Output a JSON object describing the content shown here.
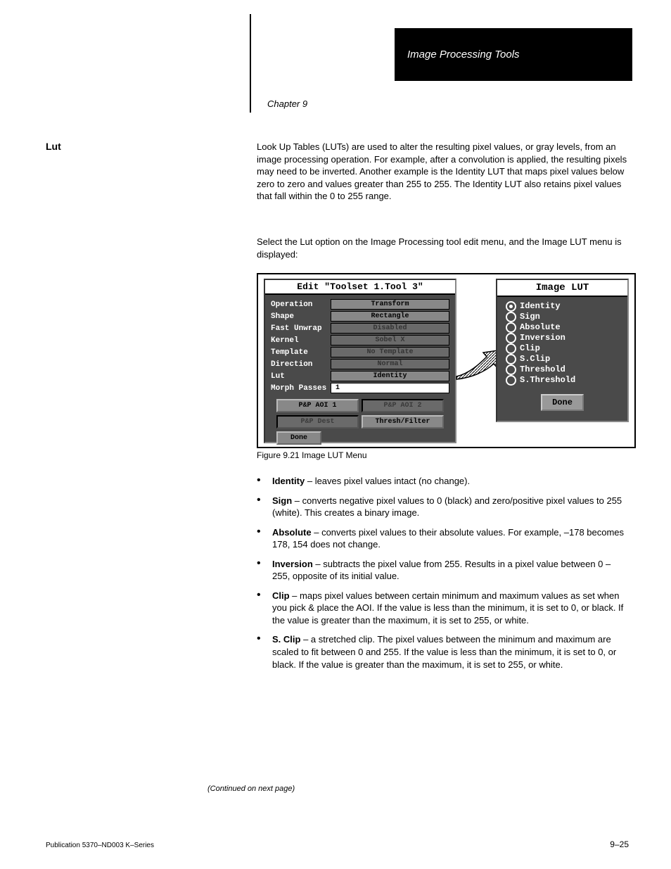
{
  "header": {
    "banner_text": "Image Processing Tools",
    "chapter": "Chapter 9"
  },
  "sections": {
    "lut_heading": "Lut",
    "lut_body": "Look Up Tables (LUTs) are used to alter the resulting pixel values, or gray levels, from an image processing operation. For example, after a convolution is applied, the resulting pixels may need to be inverted. Another example is  the Identity LUT that maps pixel values below zero to zero and values greater than 255 to 255. The Identity LUT also retains pixel values that fall within the 0 to 255 range.",
    "select_lut_body": "Select the Lut option on the Image Processing tool edit menu, and the Image LUT menu is displayed:"
  },
  "figure": {
    "caption": "Figure 9.21 Image LUT Menu",
    "edit_panel": {
      "title": "Edit \"Toolset 1.Tool 3\"",
      "rows": [
        {
          "label": "Operation",
          "value": "Transform",
          "disabled": false
        },
        {
          "label": "Shape",
          "value": "Rectangle",
          "disabled": false
        },
        {
          "label": "Fast Unwrap",
          "value": "Disabled",
          "disabled": true
        },
        {
          "label": "Kernel",
          "value": "Sobel X",
          "disabled": true
        },
        {
          "label": "Template",
          "value": "No Template",
          "disabled": true
        },
        {
          "label": "Direction",
          "value": "Normal",
          "disabled": true
        },
        {
          "label": "Lut",
          "value": "Identity",
          "disabled": false
        },
        {
          "label": "Morph Passes",
          "value": "1",
          "disabled": false,
          "input": true
        }
      ],
      "buttons_row1": [
        {
          "label": "P&P AOI 1",
          "disabled": false
        },
        {
          "label": "P&P AOI 2",
          "disabled": true
        }
      ],
      "buttons_row2": [
        {
          "label": "P&P Dest",
          "disabled": true
        },
        {
          "label": "Thresh/Filter",
          "disabled": false
        }
      ],
      "done": "Done"
    },
    "lut_panel": {
      "title": "Image LUT",
      "options": [
        {
          "label": "Identity",
          "selected": true
        },
        {
          "label": "Sign",
          "selected": false
        },
        {
          "label": "Absolute",
          "selected": false
        },
        {
          "label": "Inversion",
          "selected": false
        },
        {
          "label": "Clip",
          "selected": false
        },
        {
          "label": "S.Clip",
          "selected": false
        },
        {
          "label": "Threshold",
          "selected": false
        },
        {
          "label": "S.Threshold",
          "selected": false
        }
      ],
      "done": "Done"
    }
  },
  "bullets": [
    {
      "term": "Identity",
      "def": " – leaves pixel values intact (no change)."
    },
    {
      "term": "Sign",
      "def": " – converts negative pixel values to 0 (black) and zero/positive pixel values to 255 (white). This creates a binary image."
    },
    {
      "term": "Absolute",
      "def": " – converts pixel values to their absolute values. For example, –178 becomes 178, 154 does not change."
    },
    {
      "term": "Inversion",
      "def": " – subtracts the pixel value from 255. Results in a pixel value between 0 – 255, opposite of its initial value."
    },
    {
      "term": "Clip",
      "def": " – maps pixel values between certain minimum and maximum values as set when you pick & place the AOI. If the value is less than the minimum, it is set to 0, or black. If the value is greater than the maximum, it is set to 255, or white."
    },
    {
      "term": "S. Clip",
      "def": " – a stretched clip. The pixel values between the minimum and maximum are scaled to fit between 0 and 255. If the value is less than the minimum, it is set to 0, or black. If the value is greater than the maximum, it is set to 255, or white."
    }
  ],
  "footer": {
    "continued": "(Continued on next page)",
    "pub": "Publication 5370–ND003 K–Series",
    "page": "9–25"
  }
}
